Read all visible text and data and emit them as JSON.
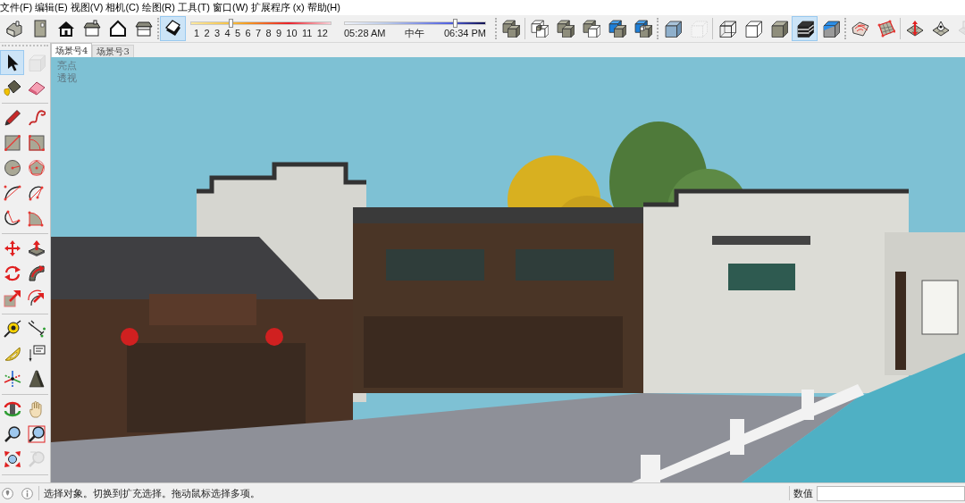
{
  "menu_bar": [
    "文件(F)",
    "编辑(E)",
    "视图(V)",
    "相机(C)",
    "绘图(R)",
    "工具(T)",
    "窗口(W)",
    "扩展程序 (x)",
    "帮助(H)"
  ],
  "toolbars": [
    {
      "groups": [
        [
          {
            "kind": "iso",
            "selected": false,
            "disabled": false
          },
          {
            "kind": "top",
            "selected": false,
            "disabled": false
          },
          {
            "kind": "front",
            "selected": false,
            "disabled": false
          },
          {
            "kind": "right",
            "selected": false,
            "disabled": false
          },
          {
            "kind": "back",
            "selected": false,
            "disabled": false
          },
          {
            "kind": "left",
            "selected": false,
            "disabled": false
          }
        ]
      ]
    },
    {
      "groups": [
        [
          {
            "kind": "shadows",
            "selected": true,
            "disabled": false
          },
          {
            "kind": "month_slider",
            "level": 0.29,
            "labels": [
              "1",
              "2",
              "3",
              "4",
              "5",
              "6",
              "7",
              "8",
              "9",
              "10",
              "11",
              "12"
            ]
          },
          {
            "kind": "time_slider",
            "level": 0.78,
            "labels": [
              "05:28 AM",
              "中午",
              "06:34 PM"
            ]
          }
        ]
      ]
    },
    {
      "groups": [
        [
          {
            "kind": "outer_shell",
            "selected": false,
            "disabled": false
          }
        ],
        [
          {
            "kind": "intersect",
            "selected": false,
            "disabled": false
          },
          {
            "kind": "union",
            "selected": false,
            "disabled": false
          },
          {
            "kind": "subtract",
            "selected": false,
            "disabled": false
          },
          {
            "kind": "trim",
            "selected": false,
            "disabled": false
          },
          {
            "kind": "split",
            "selected": false,
            "disabled": false
          }
        ]
      ]
    },
    {
      "groups": [
        [
          {
            "kind": "xray",
            "selected": false,
            "disabled": false
          },
          {
            "kind": "back_edges",
            "selected": false,
            "disabled": true
          }
        ],
        [
          {
            "kind": "wireframe",
            "selected": false,
            "disabled": false
          },
          {
            "kind": "hidden_line",
            "selected": false,
            "disabled": false
          },
          {
            "kind": "shaded",
            "selected": false,
            "disabled": false
          },
          {
            "kind": "shaded_textures",
            "selected": true,
            "disabled": false
          },
          {
            "kind": "monochrome",
            "selected": false,
            "disabled": false
          }
        ]
      ]
    },
    {
      "groups": [
        [
          {
            "kind": "contours",
            "selected": false,
            "disabled": false
          },
          {
            "kind": "scratch",
            "selected": false,
            "disabled": false
          }
        ],
        [
          {
            "kind": "smoove",
            "selected": false,
            "disabled": false
          },
          {
            "kind": "stamp",
            "selected": false,
            "disabled": false
          },
          {
            "kind": "drape",
            "selected": false,
            "disabled": true
          }
        ]
      ]
    }
  ],
  "scene_tabs": [
    {
      "label": "场景号4",
      "selected": true
    },
    {
      "label": "场景号3",
      "selected": false
    }
  ],
  "tool_palette": {
    "groups": [
      [
        {
          "kind": "select",
          "selected": true,
          "disabled": false
        },
        {
          "kind": "component",
          "selected": false,
          "disabled": true
        },
        {
          "kind": "paint",
          "selected": false,
          "disabled": false
        },
        {
          "kind": "eraser",
          "selected": false,
          "disabled": false
        }
      ],
      [
        {
          "kind": "line",
          "selected": false,
          "disabled": false
        },
        {
          "kind": "freehand",
          "selected": false,
          "disabled": false
        },
        {
          "kind": "rectangle",
          "selected": false,
          "disabled": false
        },
        {
          "kind": "rotated_rectangle",
          "selected": false,
          "disabled": false
        },
        {
          "kind": "circle",
          "selected": false,
          "disabled": false
        },
        {
          "kind": "polygon",
          "selected": false,
          "disabled": false
        },
        {
          "kind": "arc",
          "selected": false,
          "disabled": false
        },
        {
          "kind": "arc2",
          "selected": false,
          "disabled": false
        },
        {
          "kind": "arc3",
          "selected": false,
          "disabled": false
        },
        {
          "kind": "pie",
          "selected": false,
          "disabled": false
        }
      ],
      [
        {
          "kind": "move",
          "selected": false,
          "disabled": false
        },
        {
          "kind": "pushpull",
          "selected": false,
          "disabled": false
        },
        {
          "kind": "rotate",
          "selected": false,
          "disabled": false
        },
        {
          "kind": "followme",
          "selected": false,
          "disabled": false
        },
        {
          "kind": "scale",
          "selected": false,
          "disabled": false
        },
        {
          "kind": "offset",
          "selected": false,
          "disabled": false
        }
      ],
      [
        {
          "kind": "tape",
          "selected": false,
          "disabled": false
        },
        {
          "kind": "dimension",
          "selected": false,
          "disabled": false
        },
        {
          "kind": "protractor",
          "selected": false,
          "disabled": false
        },
        {
          "kind": "text",
          "selected": false,
          "disabled": false
        },
        {
          "kind": "axes",
          "selected": false,
          "disabled": false
        },
        {
          "kind": "text3d",
          "selected": false,
          "disabled": false
        }
      ],
      [
        {
          "kind": "orbit",
          "selected": false,
          "disabled": false
        },
        {
          "kind": "pan",
          "selected": false,
          "disabled": false
        },
        {
          "kind": "zoom",
          "selected": false,
          "disabled": false
        },
        {
          "kind": "zoomwindow",
          "selected": false,
          "disabled": false
        },
        {
          "kind": "zoomextents",
          "selected": false,
          "disabled": false
        },
        {
          "kind": "previous",
          "selected": false,
          "disabled": true
        }
      ]
    ]
  },
  "viewport": {
    "labels": [
      "亮点",
      "透视"
    ]
  },
  "status_bar": {
    "message": "选择对象。切换到扩充选择。拖动鼠标选择多项。",
    "measurements_label": "数值"
  }
}
